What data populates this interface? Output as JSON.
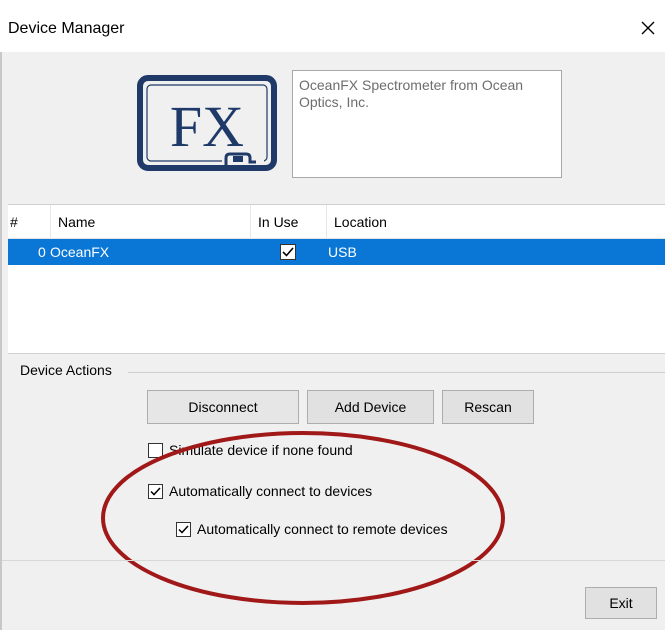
{
  "window": {
    "title": "Device Manager",
    "close_icon": "close-icon"
  },
  "device_info": {
    "logo_text": "FX",
    "description": "OceanFX Spectrometer from Ocean Optics, Inc."
  },
  "table": {
    "columns": [
      "#",
      "Name",
      "In Use",
      "Location"
    ],
    "rows": [
      {
        "index": "0",
        "name": "OceanFX",
        "in_use": true,
        "location": "USB",
        "selected": true
      }
    ],
    "selection_color": "#0a77d6"
  },
  "device_actions": {
    "group_label": "Device Actions",
    "buttons": {
      "disconnect": "Disconnect",
      "add_device": "Add Device",
      "rescan": "Rescan"
    },
    "checkboxes": {
      "simulate": {
        "label": "Simulate device if none found",
        "checked": false
      },
      "auto_connect": {
        "label": "Automatically connect to devices",
        "checked": true
      },
      "auto_connect_remote": {
        "label": "Automatically connect to remote devices",
        "checked": true
      }
    }
  },
  "footer": {
    "exit_label": "Exit"
  },
  "annotation": {
    "highlight_color": "#a01818"
  }
}
